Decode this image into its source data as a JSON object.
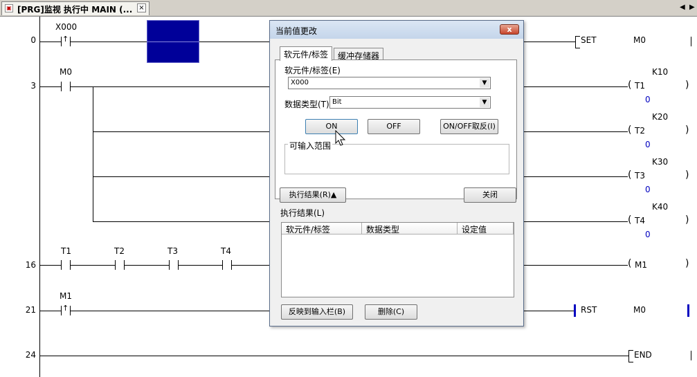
{
  "tab": {
    "title": "[PRG]监视 执行中 MAIN (...",
    "close": "×",
    "icon": "prg-icon"
  },
  "nav": {
    "left": "◀",
    "right": "▶"
  },
  "ladder": {
    "rungs": [
      {
        "num": "0",
        "contact": "X000",
        "output": "SET",
        "operand": "M0"
      },
      {
        "num": "3",
        "contact": "M0"
      },
      {
        "num": "16",
        "contacts": [
          "T1",
          "T2",
          "T3",
          "T4"
        ],
        "output": "M1"
      },
      {
        "num": "21",
        "contact": "M1",
        "output": "RST",
        "operand": "M0"
      },
      {
        "num": "24",
        "output": "END"
      }
    ],
    "timers": [
      {
        "name": "T1",
        "const": "K10",
        "value": "0"
      },
      {
        "name": "T2",
        "const": "K20",
        "value": "0"
      },
      {
        "name": "T3",
        "const": "K30",
        "value": "0"
      },
      {
        "name": "T4",
        "const": "K40",
        "value": "0"
      }
    ]
  },
  "dialog": {
    "title": "当前值更改",
    "close_label": "x",
    "tabs": [
      "软元件/标签",
      "缓冲存储器"
    ],
    "device_label": "软元件/标签(E)",
    "device_value": "X000",
    "datatype_label": "数据类型(T)",
    "datatype_value": "Bit",
    "btn_on": "ON",
    "btn_off": "OFF",
    "btn_toggle": "ON/OFF取反(I)",
    "range_label": "可输入范围",
    "btn_result": "执行结果(R)▲",
    "btn_close": "关闭",
    "result_label": "执行结果(L)",
    "table_headers": [
      "软元件/标签",
      "数据类型",
      "设定值"
    ],
    "btn_reflect": "反映到输入栏(B)",
    "btn_delete": "删除(C)"
  }
}
